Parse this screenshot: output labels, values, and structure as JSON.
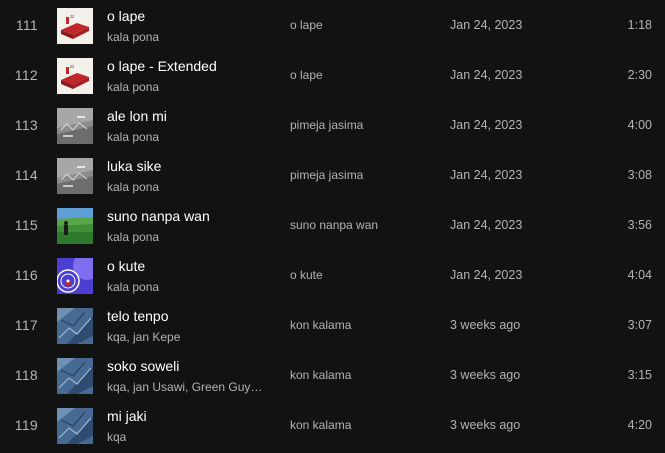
{
  "tracks": [
    {
      "number": "111",
      "title": "o lape",
      "artist": "kala pona",
      "album": "o lape",
      "date_added": "Jan 24, 2023",
      "duration": "1:18",
      "cover": "bed-cover"
    },
    {
      "number": "112",
      "title": "o lape - Extended",
      "artist": "kala pona",
      "album": "o lape",
      "date_added": "Jan 24, 2023",
      "duration": "2:30",
      "cover": "bed-cover"
    },
    {
      "number": "113",
      "title": "ale lon mi",
      "artist": "kala pona",
      "album": "pimeja jasima",
      "date_added": "Jan 24, 2023",
      "duration": "4:00",
      "cover": "gray-cover"
    },
    {
      "number": "114",
      "title": "luka sike",
      "artist": "kala pona",
      "album": "pimeja jasima",
      "date_added": "Jan 24, 2023",
      "duration": "3:08",
      "cover": "gray-cover"
    },
    {
      "number": "115",
      "title": "suno nanpa wan",
      "artist": "kala pona",
      "album": "suno nanpa wan",
      "date_added": "Jan 24, 2023",
      "duration": "3:56",
      "cover": "field-cover"
    },
    {
      "number": "116",
      "title": "o kute",
      "artist": "kala pona",
      "album": "o kute",
      "date_added": "Jan 24, 2023",
      "duration": "4:04",
      "cover": "swirl-cover"
    },
    {
      "number": "117",
      "title": "telo tenpo",
      "artist": "kqa, jan Kepe",
      "album": "kon kalama",
      "date_added": "3 weeks ago",
      "duration": "3:07",
      "cover": "blue-cover"
    },
    {
      "number": "118",
      "title": "soko soweli",
      "artist": "kqa, jan Usawi, Green Guy…",
      "album": "kon kalama",
      "date_added": "3 weeks ago",
      "duration": "3:15",
      "cover": "blue-cover"
    },
    {
      "number": "119",
      "title": "mi jaki",
      "artist": "kqa",
      "album": "kon kalama",
      "date_added": "3 weeks ago",
      "duration": "4:20",
      "cover": "blue-cover"
    }
  ],
  "colors": {
    "background": "#121212",
    "primary_text": "#ffffff",
    "secondary_text": "#b3b3b3"
  }
}
